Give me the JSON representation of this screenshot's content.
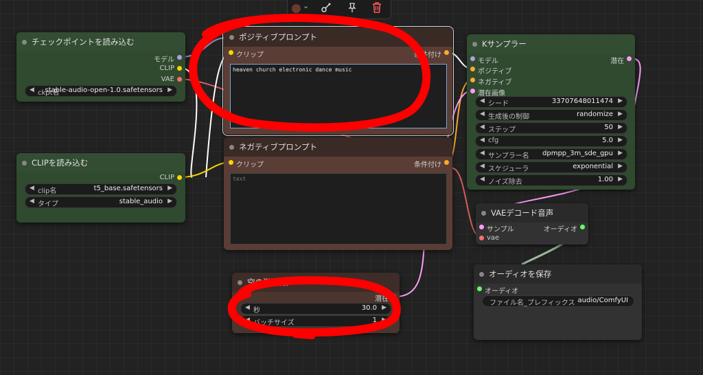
{
  "toolbar": {
    "color_icon": "color-circle-icon",
    "chevron": "⌄",
    "icons": [
      "bypass-icon",
      "pin-icon",
      "delete-icon"
    ]
  },
  "checkpoint_loader": {
    "title": "チェックポイントを読み込む",
    "outputs": [
      "モデル",
      "CLIP",
      "VAE"
    ],
    "widget_label": "ckpt名",
    "widget_value": "stable-audio-open-1.0.safetensors"
  },
  "clip_loader": {
    "title": "CLIPを読み込む",
    "output": "CLIP",
    "widgets": [
      {
        "label": "clip名",
        "value": "t5_base.safetensors"
      },
      {
        "label": "タイプ",
        "value": "stable_audio"
      }
    ]
  },
  "positive_prompt": {
    "title": "ポジティブプロンプト",
    "input": "クリップ",
    "output": "条件付け",
    "text": "heaven church electronic dance music"
  },
  "negative_prompt": {
    "title": "ネガティブプロンプト",
    "input": "クリップ",
    "output": "条件付け",
    "placeholder": "text"
  },
  "ksampler": {
    "title": "Kサンプラー",
    "inputs": [
      "モデル",
      "ポジティブ",
      "ネガティブ",
      "潜在画像"
    ],
    "output": "潜在",
    "widgets": [
      {
        "label": "シード",
        "value": "33707648011474"
      },
      {
        "label": "生成後の制御",
        "value": "randomize"
      },
      {
        "label": "ステップ",
        "value": "50"
      },
      {
        "label": "cfg",
        "value": "5.0"
      },
      {
        "label": "サンプラー名",
        "value": "dpmpp_3m_sde_gpu"
      },
      {
        "label": "スケジューラ",
        "value": "exponential"
      },
      {
        "label": "ノイズ除去",
        "value": "1.00"
      }
    ]
  },
  "vae_decode": {
    "title": "VAEデコード音声",
    "inputs": [
      "サンプル",
      "vae"
    ],
    "output": "オーディオ"
  },
  "save_audio": {
    "title": "オーディオを保存",
    "input": "オーディオ",
    "widget_label": "ファイル名_プレフィックス",
    "widget_value": "audio/ComfyUI"
  },
  "empty_latent": {
    "title": "空の潜在音声",
    "output": "潜在",
    "widgets": [
      {
        "label": "秒",
        "value": "30.0"
      },
      {
        "label": "バッチサイズ",
        "value": "1"
      }
    ]
  },
  "colors": {
    "model": "#b39ddb",
    "clip": "#ffd500",
    "vae": "#ff6e6e",
    "conditioning": "#ffa931",
    "latent": "#ff9cf9",
    "audio": "#64ff64",
    "annotation": "#ff0000"
  }
}
